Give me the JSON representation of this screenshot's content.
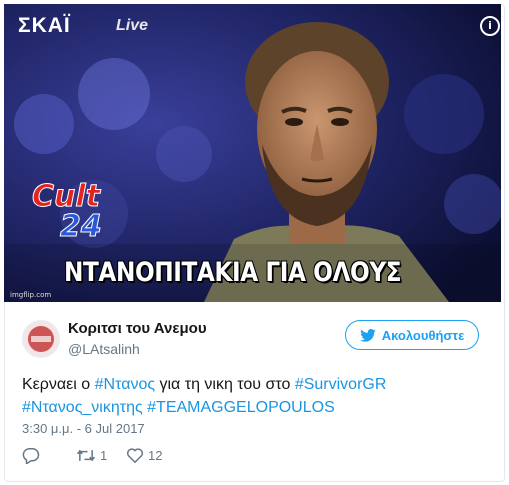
{
  "media": {
    "channel": "ΣΚΑΪ",
    "live_label": "Live",
    "show_logo_top": "Cult",
    "show_logo_bottom": "24",
    "caption": "ΝΤΑΝΟΠΙΤΑΚΙΑ ΓΙΑ ΟΛΟΥΣ",
    "watermark": "imgflip.com",
    "info_icon": "info-icon"
  },
  "user": {
    "display_name": "Κοριτσι του Ανεμου",
    "handle": "@LAtsalinh"
  },
  "follow_button": {
    "label": "Ακολουθήστε",
    "icon": "twitter-bird-icon"
  },
  "tweet": {
    "text_prefix": "Κερναει ο ",
    "tag1": "#Ντανος",
    "text_middle": " για τη νικη του στο ",
    "tag2": "#SurvivorGR",
    "tag3": "#Ντανος_νικητης",
    "tag4": "#TEAMAGGELOPOULOS",
    "timestamp": "3:30 μ.μ. - 6 Jul 2017"
  },
  "actions": {
    "reply_icon": "reply-icon",
    "retweet_icon": "retweet-icon",
    "retweet_count": "1",
    "like_icon": "heart-icon",
    "like_count": "12"
  },
  "colors": {
    "accent": "#1da1f2",
    "hashtag": "#1b95e0",
    "muted": "#657786"
  }
}
